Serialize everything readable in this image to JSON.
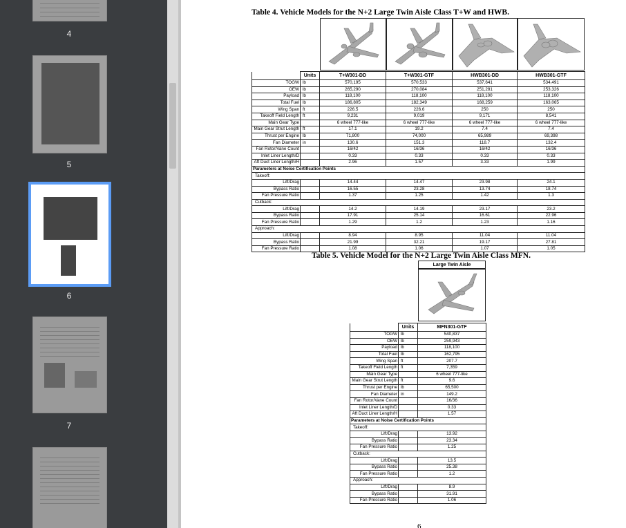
{
  "thumbnails": [
    {
      "label": "4"
    },
    {
      "label": "5"
    },
    {
      "label": "6"
    },
    {
      "label": "7"
    }
  ],
  "table4": {
    "caption": "Table 4. Vehicle Models for the N+2 Large Twin Aisle Class T+W and HWB.",
    "units_header": "Units",
    "columns": [
      "T+W301-DD",
      "T+W301-GTF",
      "HWB301-DD",
      "HWB301-GTF"
    ],
    "rows": [
      {
        "label": "TOGW",
        "unit": "lb",
        "values": [
          "570,195",
          "570,533",
          "537,641",
          "534,491"
        ]
      },
      {
        "label": "OEW",
        "unit": "lb",
        "values": [
          "265,290",
          "270,084",
          "251,281",
          "253,326"
        ]
      },
      {
        "label": "Payload",
        "unit": "lb",
        "values": [
          "118,100",
          "118,100",
          "118,100",
          "118,100"
        ]
      },
      {
        "label": "Total Fuel",
        "unit": "lb",
        "values": [
          "186,805",
          "182,349",
          "168,259",
          "163,065"
        ]
      },
      {
        "label": "Wing Span",
        "unit": "ft",
        "values": [
          "226.5",
          "226.6",
          "250",
          "250"
        ]
      },
      {
        "label": "Takeoff Field Length",
        "unit": "ft",
        "values": [
          "9,231",
          "9,019",
          "9,171",
          "8,541"
        ]
      },
      {
        "label": "Main Gear Type",
        "unit": "",
        "values": [
          "6 wheel 777-like",
          "6 wheel 777-like",
          "6 wheel 777-like",
          "6 wheel 777-like"
        ]
      },
      {
        "label": "Main Gear Strut Length",
        "unit": "ft",
        "values": [
          "17.1",
          "19.2",
          "7.4",
          "7.4"
        ]
      },
      {
        "label": "Thrust per Engine",
        "unit": "lb",
        "values": [
          "71,800",
          "74,000",
          "65,989",
          "69,398"
        ]
      },
      {
        "label": "Fan Diameter",
        "unit": "in",
        "values": [
          "130.6",
          "151.3",
          "118.7",
          "132.4"
        ]
      },
      {
        "label": "Fan Rotor/Vane Count",
        "unit": "",
        "values": [
          "16/42",
          "16/36",
          "16/42",
          "16/36"
        ]
      },
      {
        "label": "Inlet Liner Length/D",
        "unit": "",
        "values": [
          "0.33",
          "0.33",
          "0.33",
          "0.33"
        ]
      },
      {
        "label": "Aft Duct Liner Length/H",
        "unit": "",
        "values": [
          "2.96",
          "1.57",
          "3.33",
          "1.99"
        ]
      }
    ],
    "section_title": "Parameters at Noise Certification Points",
    "groups": [
      {
        "name": "Takeoff:",
        "rows": [
          {
            "label": "Lift/Drag",
            "values": [
              "14.44",
              "14.47",
              "23.98",
              "24.1"
            ]
          },
          {
            "label": "Bypass Ratio",
            "values": [
              "16.55",
              "23.28",
              "13.74",
              "18.74"
            ]
          },
          {
            "label": "Fan Pressure Ratio",
            "values": [
              "1.37",
              "1.25",
              "1.42",
              "1.3"
            ]
          }
        ]
      },
      {
        "name": "Cutback:",
        "rows": [
          {
            "label": "Lift/Drag",
            "values": [
              "14.2",
              "14.19",
              "23.17",
              "23.2"
            ]
          },
          {
            "label": "Bypass Ratio",
            "values": [
              "17.91",
              "25.14",
              "16.61",
              "22.96"
            ]
          },
          {
            "label": "Fan Pressure Ratio",
            "values": [
              "1.29",
              "1.2",
              "1.23",
              "1.16"
            ]
          }
        ]
      },
      {
        "name": "Approach:",
        "rows": [
          {
            "label": "Lift/Drag",
            "values": [
              "8.94",
              "8.95",
              "11.04",
              "11.04"
            ]
          },
          {
            "label": "Bypass Ratio",
            "values": [
              "21.99",
              "32.21",
              "19.17",
              "27.81"
            ]
          },
          {
            "label": "Fan Pressure Ratio",
            "values": [
              "1.08",
              "1.06",
              "1.07",
              "1.05"
            ]
          }
        ]
      }
    ]
  },
  "table5": {
    "caption": "Table 5. Vehicle Model for the N+2 Large Twin Aisle Class MFN.",
    "class_header": "Large Twin Aisle",
    "units_header": "Units",
    "column": "MFN301-GTF",
    "rows": [
      {
        "label": "TOGW",
        "unit": "lb",
        "value": "540,837"
      },
      {
        "label": "OEW",
        "unit": "lb",
        "value": "259,943"
      },
      {
        "label": "Payload",
        "unit": "lb",
        "value": "118,100"
      },
      {
        "label": "Total Fuel",
        "unit": "lb",
        "value": "162,795"
      },
      {
        "label": "Wing Span",
        "unit": "ft",
        "value": "207.7"
      },
      {
        "label": "Takeoff Field Length",
        "unit": "ft",
        "value": "7,359"
      },
      {
        "label": "Main Gear Type",
        "unit": "",
        "value": "6 wheel 777-like"
      },
      {
        "label": "Main Gear Strut Length",
        "unit": "ft",
        "value": "9.6"
      },
      {
        "label": "Thrust per Engine",
        "unit": "lb",
        "value": "65,500"
      },
      {
        "label": "Fan Diameter",
        "unit": "in",
        "value": "149.2"
      },
      {
        "label": "Fan Rotor/Vane Count",
        "unit": "",
        "value": "16/36"
      },
      {
        "label": "Inlet Liner Length/D",
        "unit": "",
        "value": "0.33"
      },
      {
        "label": "Aft Duct Liner Length/H",
        "unit": "",
        "value": "1.57"
      }
    ],
    "section_title": "Parameters at Noise Certification Points",
    "groups": [
      {
        "name": "Takeoff:",
        "rows": [
          {
            "label": "Lift/Drag",
            "value": "13.92"
          },
          {
            "label": "Bypass Ratio",
            "value": "23.34"
          },
          {
            "label": "Fan Pressure Ratio",
            "value": "1.25"
          }
        ]
      },
      {
        "name": "Cutback:",
        "rows": [
          {
            "label": "Lift/Drag",
            "value": "13.5"
          },
          {
            "label": "Bypass Ratio",
            "value": "25.38"
          },
          {
            "label": "Fan Pressure Ratio",
            "value": "1.2"
          }
        ]
      },
      {
        "name": "Approach:",
        "rows": [
          {
            "label": "Lift/Drag",
            "value": "8.9"
          },
          {
            "label": "Bypass Ratio",
            "value": "31.91"
          },
          {
            "label": "Fan Pressure Ratio",
            "value": "1.06"
          }
        ]
      }
    ]
  },
  "page_number": "6"
}
